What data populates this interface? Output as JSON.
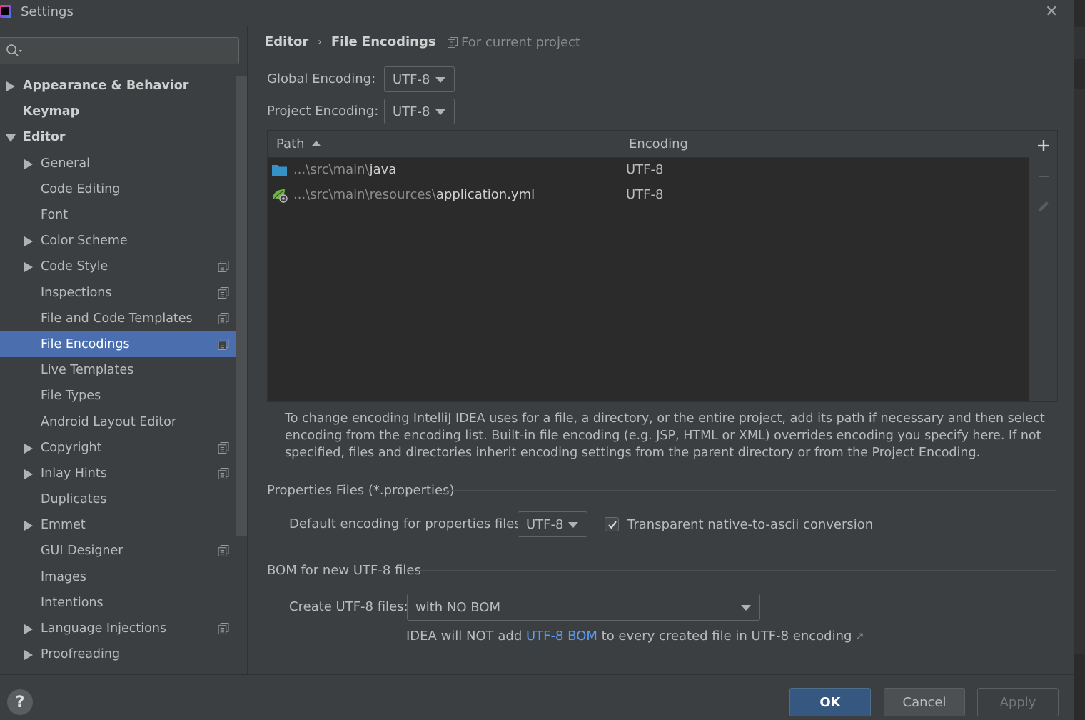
{
  "window": {
    "title": "Settings"
  },
  "search": {
    "placeholder": "",
    "value": ""
  },
  "sidebar": {
    "items": [
      {
        "label": "Appearance & Behavior",
        "level": 0,
        "arrow": "right",
        "bold": true,
        "project": false
      },
      {
        "label": "Keymap",
        "level": 0,
        "arrow": "none",
        "bold": true,
        "project": false
      },
      {
        "label": "Editor",
        "level": 0,
        "arrow": "down",
        "bold": true,
        "project": false
      },
      {
        "label": "General",
        "level": 1,
        "arrow": "right",
        "bold": false,
        "project": false
      },
      {
        "label": "Code Editing",
        "level": 1,
        "arrow": "none",
        "bold": false,
        "project": false
      },
      {
        "label": "Font",
        "level": 1,
        "arrow": "none",
        "bold": false,
        "project": false
      },
      {
        "label": "Color Scheme",
        "level": 1,
        "arrow": "right",
        "bold": false,
        "project": false
      },
      {
        "label": "Code Style",
        "level": 1,
        "arrow": "right",
        "bold": false,
        "project": true
      },
      {
        "label": "Inspections",
        "level": 1,
        "arrow": "none",
        "bold": false,
        "project": true
      },
      {
        "label": "File and Code Templates",
        "level": 1,
        "arrow": "none",
        "bold": false,
        "project": true
      },
      {
        "label": "File Encodings",
        "level": 1,
        "arrow": "none",
        "bold": false,
        "project": true,
        "selected": true
      },
      {
        "label": "Live Templates",
        "level": 1,
        "arrow": "none",
        "bold": false,
        "project": false
      },
      {
        "label": "File Types",
        "level": 1,
        "arrow": "none",
        "bold": false,
        "project": false
      },
      {
        "label": "Android Layout Editor",
        "level": 1,
        "arrow": "none",
        "bold": false,
        "project": false
      },
      {
        "label": "Copyright",
        "level": 1,
        "arrow": "right",
        "bold": false,
        "project": true
      },
      {
        "label": "Inlay Hints",
        "level": 1,
        "arrow": "right",
        "bold": false,
        "project": true
      },
      {
        "label": "Duplicates",
        "level": 1,
        "arrow": "none",
        "bold": false,
        "project": false
      },
      {
        "label": "Emmet",
        "level": 1,
        "arrow": "right",
        "bold": false,
        "project": false
      },
      {
        "label": "GUI Designer",
        "level": 1,
        "arrow": "none",
        "bold": false,
        "project": true
      },
      {
        "label": "Images",
        "level": 1,
        "arrow": "none",
        "bold": false,
        "project": false
      },
      {
        "label": "Intentions",
        "level": 1,
        "arrow": "none",
        "bold": false,
        "project": false
      },
      {
        "label": "Language Injections",
        "level": 1,
        "arrow": "right",
        "bold": false,
        "project": true
      },
      {
        "label": "Proofreading",
        "level": 1,
        "arrow": "right",
        "bold": false,
        "project": false
      }
    ]
  },
  "breadcrumb": {
    "parent": "Editor",
    "current": "File Encodings",
    "scope": "For current project"
  },
  "encodings": {
    "global_label": "Global Encoding:",
    "global_value": "UTF-8",
    "project_label": "Project Encoding:",
    "project_value": "UTF-8"
  },
  "table": {
    "col_path": "Path",
    "col_encoding": "Encoding",
    "rows": [
      {
        "path_prefix": "...\\src\\main\\",
        "path_name": "java",
        "encoding": "UTF-8",
        "icon": "folder-icon"
      },
      {
        "path_prefix": "...\\src\\main\\resources\\",
        "path_name": "application.yml",
        "encoding": "UTF-8",
        "icon": "spring-config-icon"
      }
    ]
  },
  "help_text": "To change encoding IntelliJ IDEA uses for a file, a directory, or the entire project, add its path if necessary and then select encoding from the encoding list. Built-in file encoding (e.g. JSP, HTML or XML) overrides encoding you specify here. If not specified, files and directories inherit encoding settings from the parent directory or from the Project Encoding.",
  "properties": {
    "section_title": "Properties Files (*.properties)",
    "default_label": "Default encoding for properties files:",
    "default_value": "UTF-8",
    "native_ascii_label": "Transparent native-to-ascii conversion",
    "native_ascii_checked": true
  },
  "bom": {
    "section_title": "BOM for new UTF-8 files",
    "create_label": "Create UTF-8 files:",
    "create_value": "with NO BOM",
    "note_before": "IDEA will NOT add ",
    "note_link": "UTF-8 BOM",
    "note_after": " to every created file in UTF-8 encoding",
    "note_ext": "↗"
  },
  "footer": {
    "help": "?",
    "ok": "OK",
    "cancel": "Cancel",
    "apply": "Apply"
  },
  "colors": {
    "selection": "#4b6eaf",
    "link": "#589df6",
    "ok_button": "#365880",
    "background": "#3c3f41"
  }
}
